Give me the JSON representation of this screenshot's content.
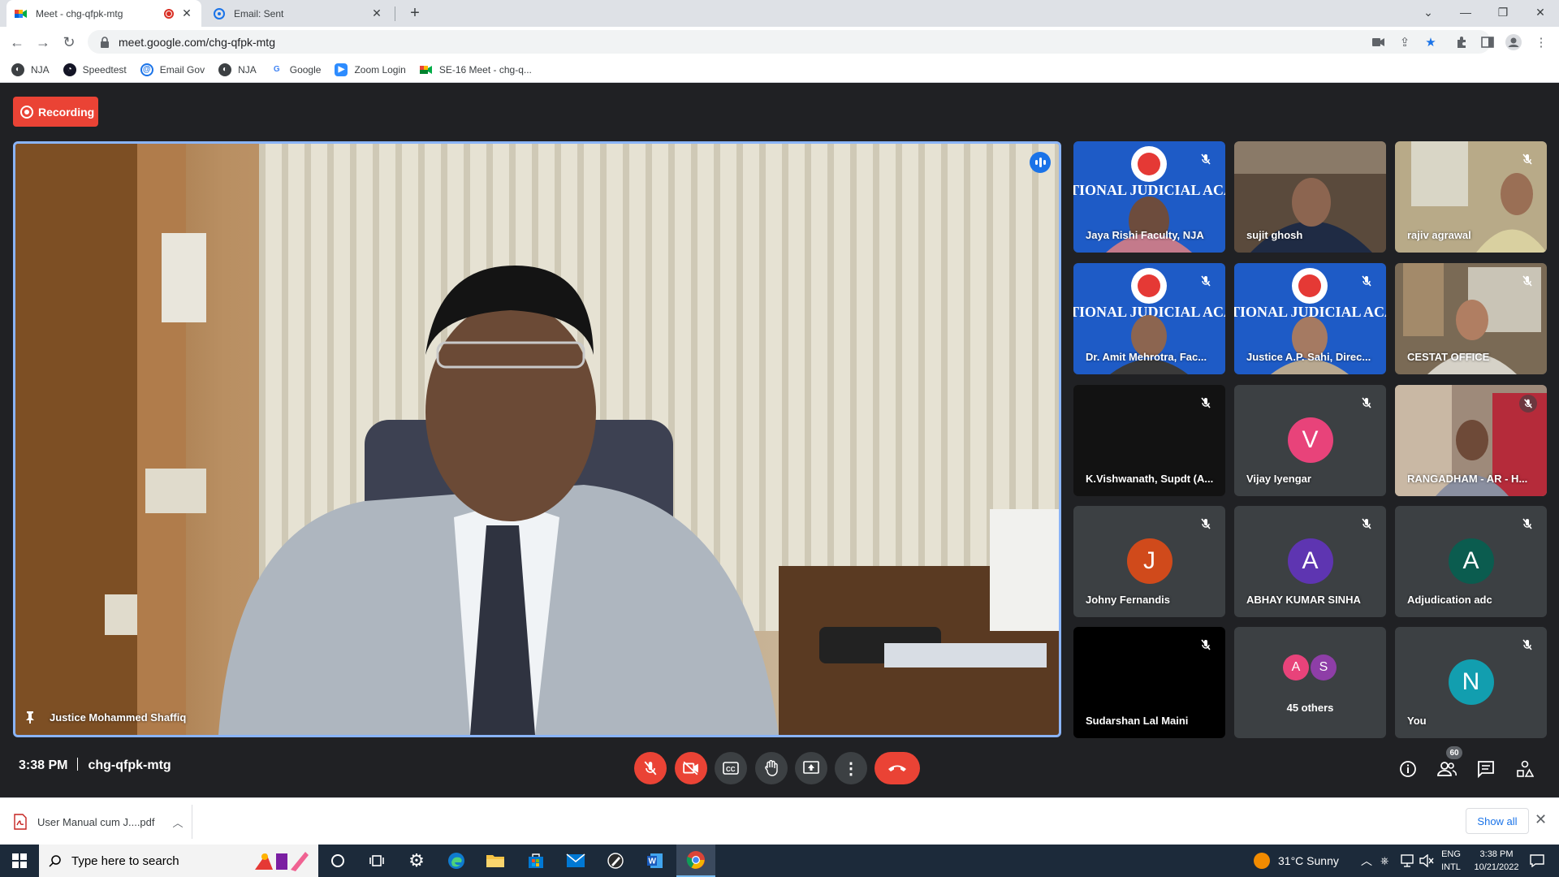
{
  "browser": {
    "tabs": [
      {
        "title": "Meet - chg-qfpk-mtg",
        "active": true
      },
      {
        "title": "Email: Sent",
        "active": false
      }
    ],
    "url": "meet.google.com/chg-qfpk-mtg",
    "bookmarks": [
      "NJA",
      "Speedtest",
      "Email Gov",
      "NJA",
      "Google",
      "Zoom Login",
      "SE-16 Meet - chg-q..."
    ]
  },
  "meet": {
    "recording_label": "Recording",
    "main_speaker": "Justice Mohammed Shaffiq",
    "participants": [
      {
        "name": "Jaya Rishi Faculty, NJA"
      },
      {
        "name": "sujit ghosh"
      },
      {
        "name": "rajiv agrawal"
      },
      {
        "name": "Dr. Amit Mehrotra, Fac..."
      },
      {
        "name": "Justice A.P. Sahi, Direc..."
      },
      {
        "name": "CESTAT OFFICE"
      },
      {
        "name": "K.Vishwanath, Supdt (A..."
      },
      {
        "name": "Vijay Iyengar",
        "initial": "V",
        "color": "#e8437a"
      },
      {
        "name": "RANGADHAM - AR - H..."
      },
      {
        "name": "Johny Fernandis",
        "initial": "J",
        "color": "#d04a1b"
      },
      {
        "name": "ABHAY KUMAR SINHA",
        "initial": "A",
        "color": "#5e35b1"
      },
      {
        "name": "Adjudication adc",
        "initial": "A",
        "color": "#0b5c4f"
      },
      {
        "name": "Sudarshan Lal Maini"
      },
      {
        "name": "You",
        "initial": "N",
        "color": "#129eaf"
      }
    ],
    "others": {
      "label": "45 others",
      "initials": [
        "A",
        "S"
      ],
      "colors": [
        "#e8437a",
        "#8e3ea7"
      ]
    },
    "time": "3:38 PM",
    "meeting_code": "chg-qfpk-mtg",
    "people_count": "60"
  },
  "downloads": {
    "file": "User Manual cum J....pdf",
    "show_all": "Show all"
  },
  "taskbar": {
    "search_placeholder": "Type here to search",
    "weather": "31°C  Sunny",
    "lang_top": "ENG",
    "lang_bottom": "INTL",
    "time": "3:38 PM",
    "date": "10/21/2022"
  }
}
